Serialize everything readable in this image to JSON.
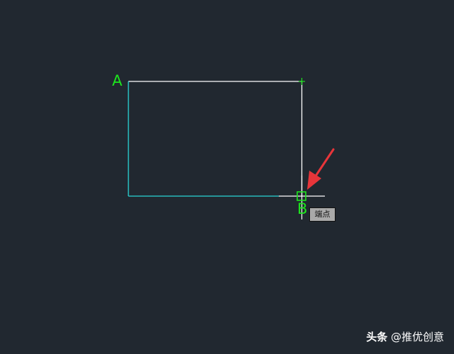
{
  "canvas": {
    "background": "#212830",
    "colors": {
      "edge_white": "#ffffff",
      "edge_cyan": "#2ad6d6",
      "snap_green": "#1ee51e",
      "arrow_red": "#e8353a"
    }
  },
  "points": {
    "a_label": "A",
    "b_label": "B"
  },
  "snap": {
    "tooltip": "端点",
    "marker_icon": "endpoint-snap-square-icon"
  },
  "watermark": {
    "brand": "头条",
    "handle": "@推优创意"
  }
}
